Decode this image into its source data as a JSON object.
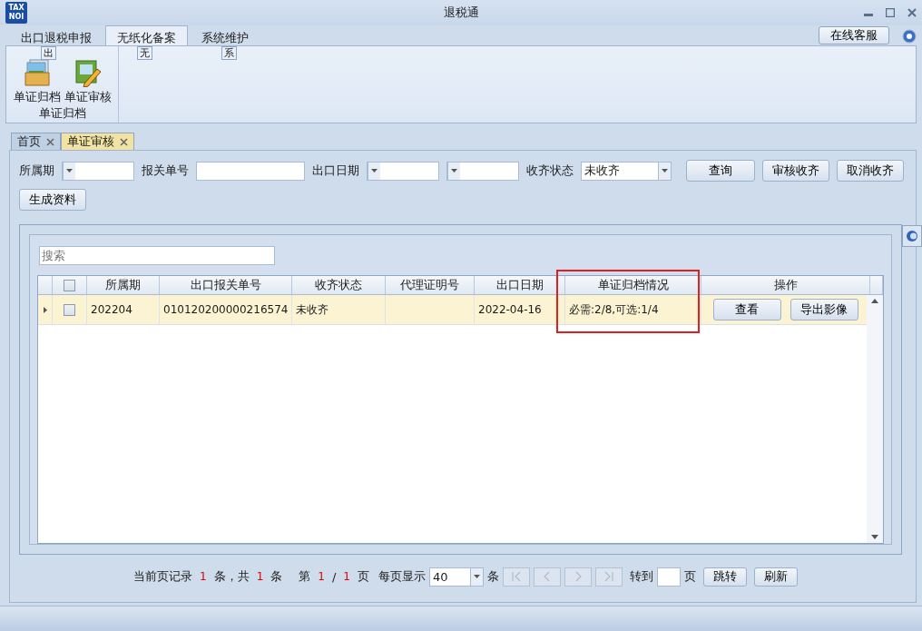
{
  "window": {
    "title": "退税通",
    "logo_top": "TAX",
    "logo_bottom": "NOI"
  },
  "ribbon": {
    "tabs": [
      {
        "label": "出口退税申报",
        "selected": false,
        "keytip": "出"
      },
      {
        "label": "无纸化备案",
        "selected": true,
        "keytip": "无"
      },
      {
        "label": "系统维护",
        "selected": false,
        "keytip": "系"
      }
    ],
    "online_service": "在线客服",
    "groups": [
      {
        "label": "单证归档",
        "items": [
          {
            "label": "单证归档",
            "kind": "archive"
          },
          {
            "label": "单证审核",
            "kind": "review"
          }
        ]
      }
    ]
  },
  "doc_tabs": [
    {
      "label": "首页",
      "selected": false
    },
    {
      "label": "单证审核",
      "selected": true
    }
  ],
  "filters": {
    "period_label": "所属期",
    "decl_label": "报关单号",
    "date_label": "出口日期",
    "status_label": "收齐状态",
    "status_value": "未收齐"
  },
  "buttons": [
    "查询",
    "审核收齐",
    "取消收齐",
    "生成资料"
  ],
  "search": {
    "placeholder": "搜索"
  },
  "table": {
    "columns": [
      {
        "label": "所属期",
        "highlighted": false
      },
      {
        "label": "出口报关单号",
        "highlighted": false
      },
      {
        "label": "收齐状态",
        "highlighted": false
      },
      {
        "label": "代理证明号",
        "highlighted": false
      },
      {
        "label": "出口日期",
        "highlighted": false
      },
      {
        "label": "单证归档情况",
        "highlighted": true
      },
      {
        "label": "操作",
        "highlighted": false
      }
    ],
    "select_all_checked": false,
    "rows": [
      {
        "checked": false,
        "current": true,
        "cells": [
          "202204",
          "010120200000216574",
          "未收齐",
          "",
          "2022-04-16",
          "必需:2/8,可选:1/4"
        ],
        "actions": [
          "查看",
          "导出影像"
        ]
      }
    ]
  },
  "pager": {
    "p1": "当前页记录",
    "current": "1",
    "p2": "条，共",
    "total": "1",
    "p3": "条",
    "p4": "第",
    "page": "1",
    "slash": "/",
    "pages": "1",
    "p5": "页",
    "per_label": "每页显示",
    "per_page": "40",
    "per_unit": "条",
    "nav": [
      {
        "kind": "first",
        "disabled": true
      },
      {
        "kind": "prev",
        "disabled": true
      },
      {
        "kind": "next",
        "disabled": true
      },
      {
        "kind": "last",
        "disabled": true
      }
    ],
    "goto_label": "转到",
    "goto_unit": "页",
    "buttons": [
      "跳转",
      "刷新"
    ]
  }
}
